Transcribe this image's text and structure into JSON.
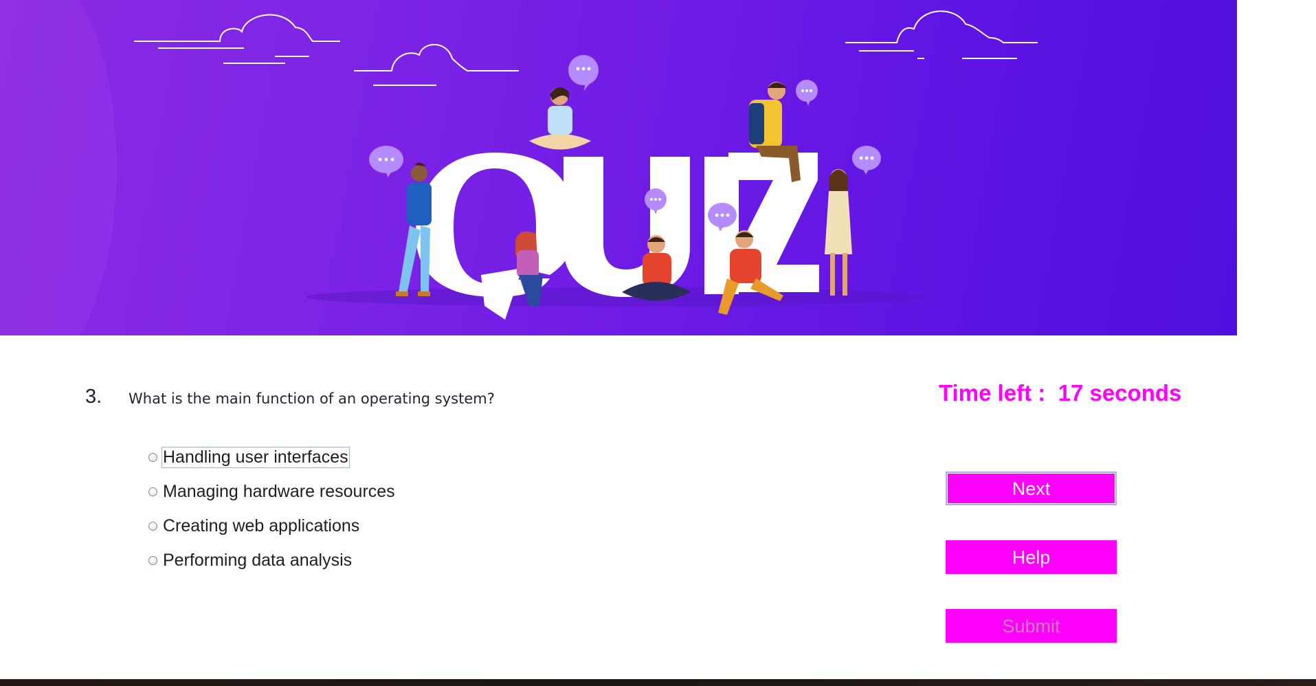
{
  "banner": {
    "title": "QUIZ",
    "colors": {
      "gradient_start": "#8a2be2",
      "gradient_end": "#4f0fe0",
      "letters": "#ffffff",
      "bubbles": "#b58cff"
    }
  },
  "question": {
    "number": "3.",
    "text": "What is the main function of an operating system?",
    "options": [
      {
        "label": "Handling user interfaces",
        "selected": false,
        "focused": true
      },
      {
        "label": "Managing hardware resources",
        "selected": false,
        "focused": false
      },
      {
        "label": "Creating web applications",
        "selected": false,
        "focused": false
      },
      {
        "label": "Performing data analysis",
        "selected": false,
        "focused": false
      }
    ]
  },
  "timer": {
    "label": "Time left :",
    "value": "17 seconds"
  },
  "buttons": {
    "next": "Next",
    "help": "Help",
    "submit": "Submit"
  },
  "colors": {
    "accent": "#ff00ff",
    "submit_text_disabled": "#c77fb8"
  }
}
